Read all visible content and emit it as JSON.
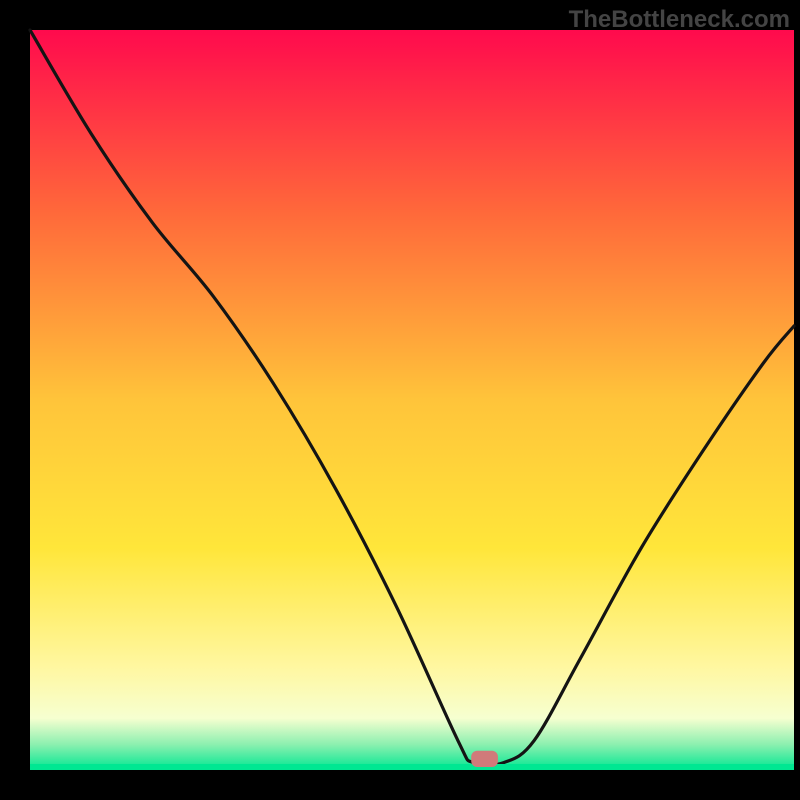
{
  "watermark": "TheBottleneck.com",
  "chart_data": {
    "type": "line",
    "title": "",
    "xlabel": "",
    "ylabel": "",
    "xlim": [
      0,
      100
    ],
    "ylim": [
      0,
      100
    ],
    "legend": null,
    "annotations": [],
    "gradient_bands": [
      {
        "stop": 0.0,
        "color": "#ff0a4d"
      },
      {
        "stop": 0.25,
        "color": "#ff6a3a"
      },
      {
        "stop": 0.5,
        "color": "#ffc43a"
      },
      {
        "stop": 0.7,
        "color": "#ffe63a"
      },
      {
        "stop": 0.86,
        "color": "#fff7a0"
      },
      {
        "stop": 0.93,
        "color": "#f6ffd0"
      },
      {
        "stop": 0.965,
        "color": "#8ef0b0"
      },
      {
        "stop": 1.0,
        "color": "#00e792"
      }
    ],
    "series": [
      {
        "name": "bottleneck-curve",
        "x": [
          0,
          8,
          16,
          24,
          32,
          40,
          48,
          56,
          58,
          62,
          66,
          72,
          80,
          88,
          96,
          100
        ],
        "y": [
          100,
          86,
          74,
          64,
          52,
          38,
          22,
          4,
          1,
          1,
          4,
          15,
          30,
          43,
          55,
          60
        ]
      }
    ],
    "marker": {
      "name": "optimal-marker",
      "x": 59.5,
      "y": 1.5,
      "color": "#d07a7a",
      "width": 3.5,
      "height": 2.2
    },
    "baseline_color": "#00e792",
    "frame_color": "#000000",
    "curve_color": "#141414"
  }
}
